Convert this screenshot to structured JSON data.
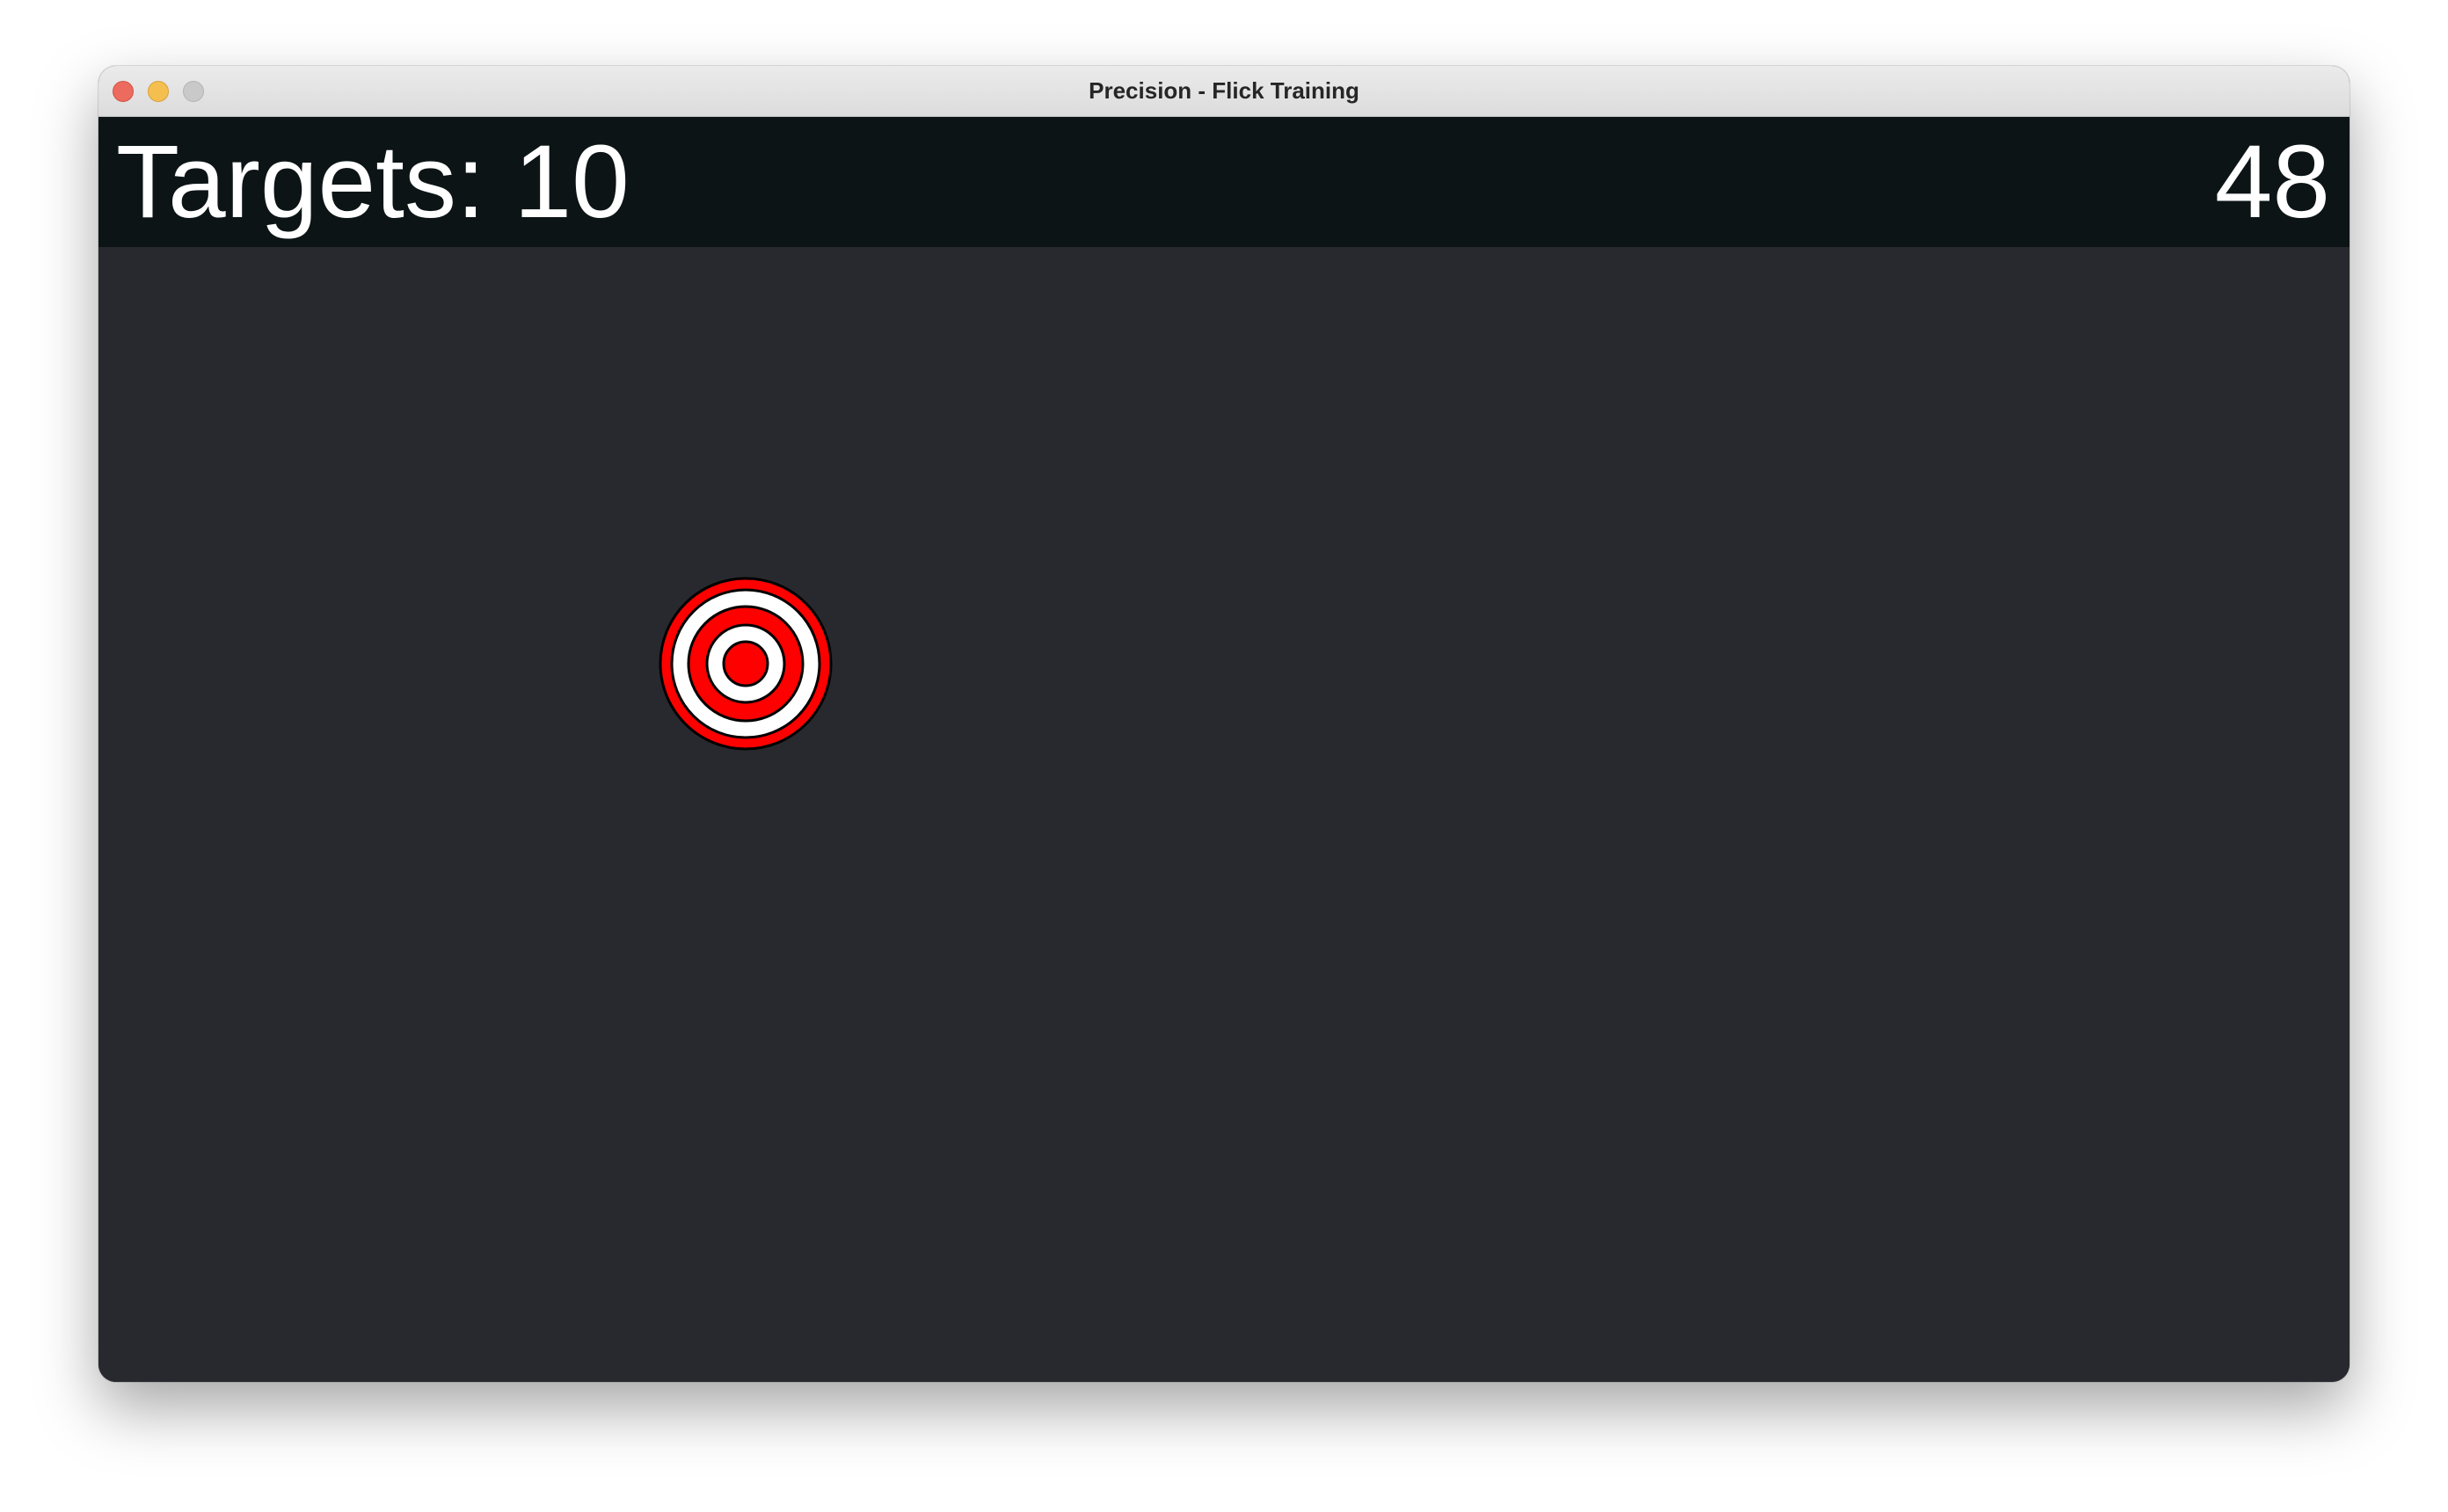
{
  "window": {
    "title": "Precision - Flick Training"
  },
  "hud": {
    "targets_text": "Targets: 10",
    "timer_value": "48"
  },
  "target": {
    "icon": "bullseye-target-icon",
    "ring_color": "#ff0000",
    "alt_color": "#ffffff",
    "outline_color": "#000000"
  },
  "colors": {
    "playfield_bg": "#28292e",
    "hud_bg": "#0c1416",
    "hud_text": "#ffffff"
  }
}
